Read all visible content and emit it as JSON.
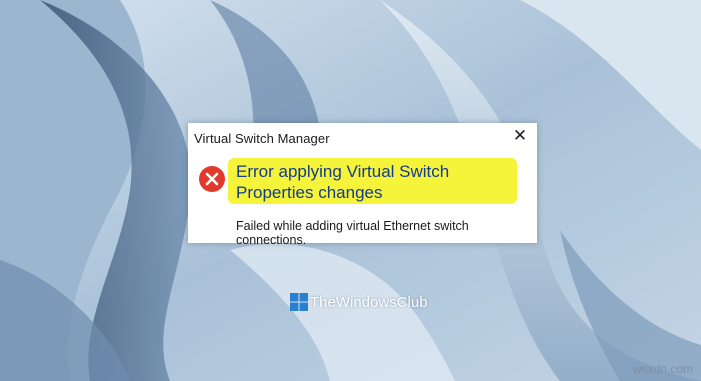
{
  "dialog": {
    "title": "Virtual Switch Manager",
    "close_glyph": "✕",
    "icon": "error-icon",
    "heading": "Error applying Virtual Switch Properties changes",
    "message": "Failed while adding virtual Ethernet switch connections."
  },
  "watermark": {
    "text": "TheWindowsClub",
    "icon": "windows-logo-icon"
  },
  "corner_label": "wsxdn.com",
  "colors": {
    "wallpaper": "#b9cfe0",
    "wallpaper_dark": "#3e5a7d",
    "highlight": "#f5f33a",
    "heading_text": "#123b8c",
    "error_red": "#e03a2c"
  }
}
